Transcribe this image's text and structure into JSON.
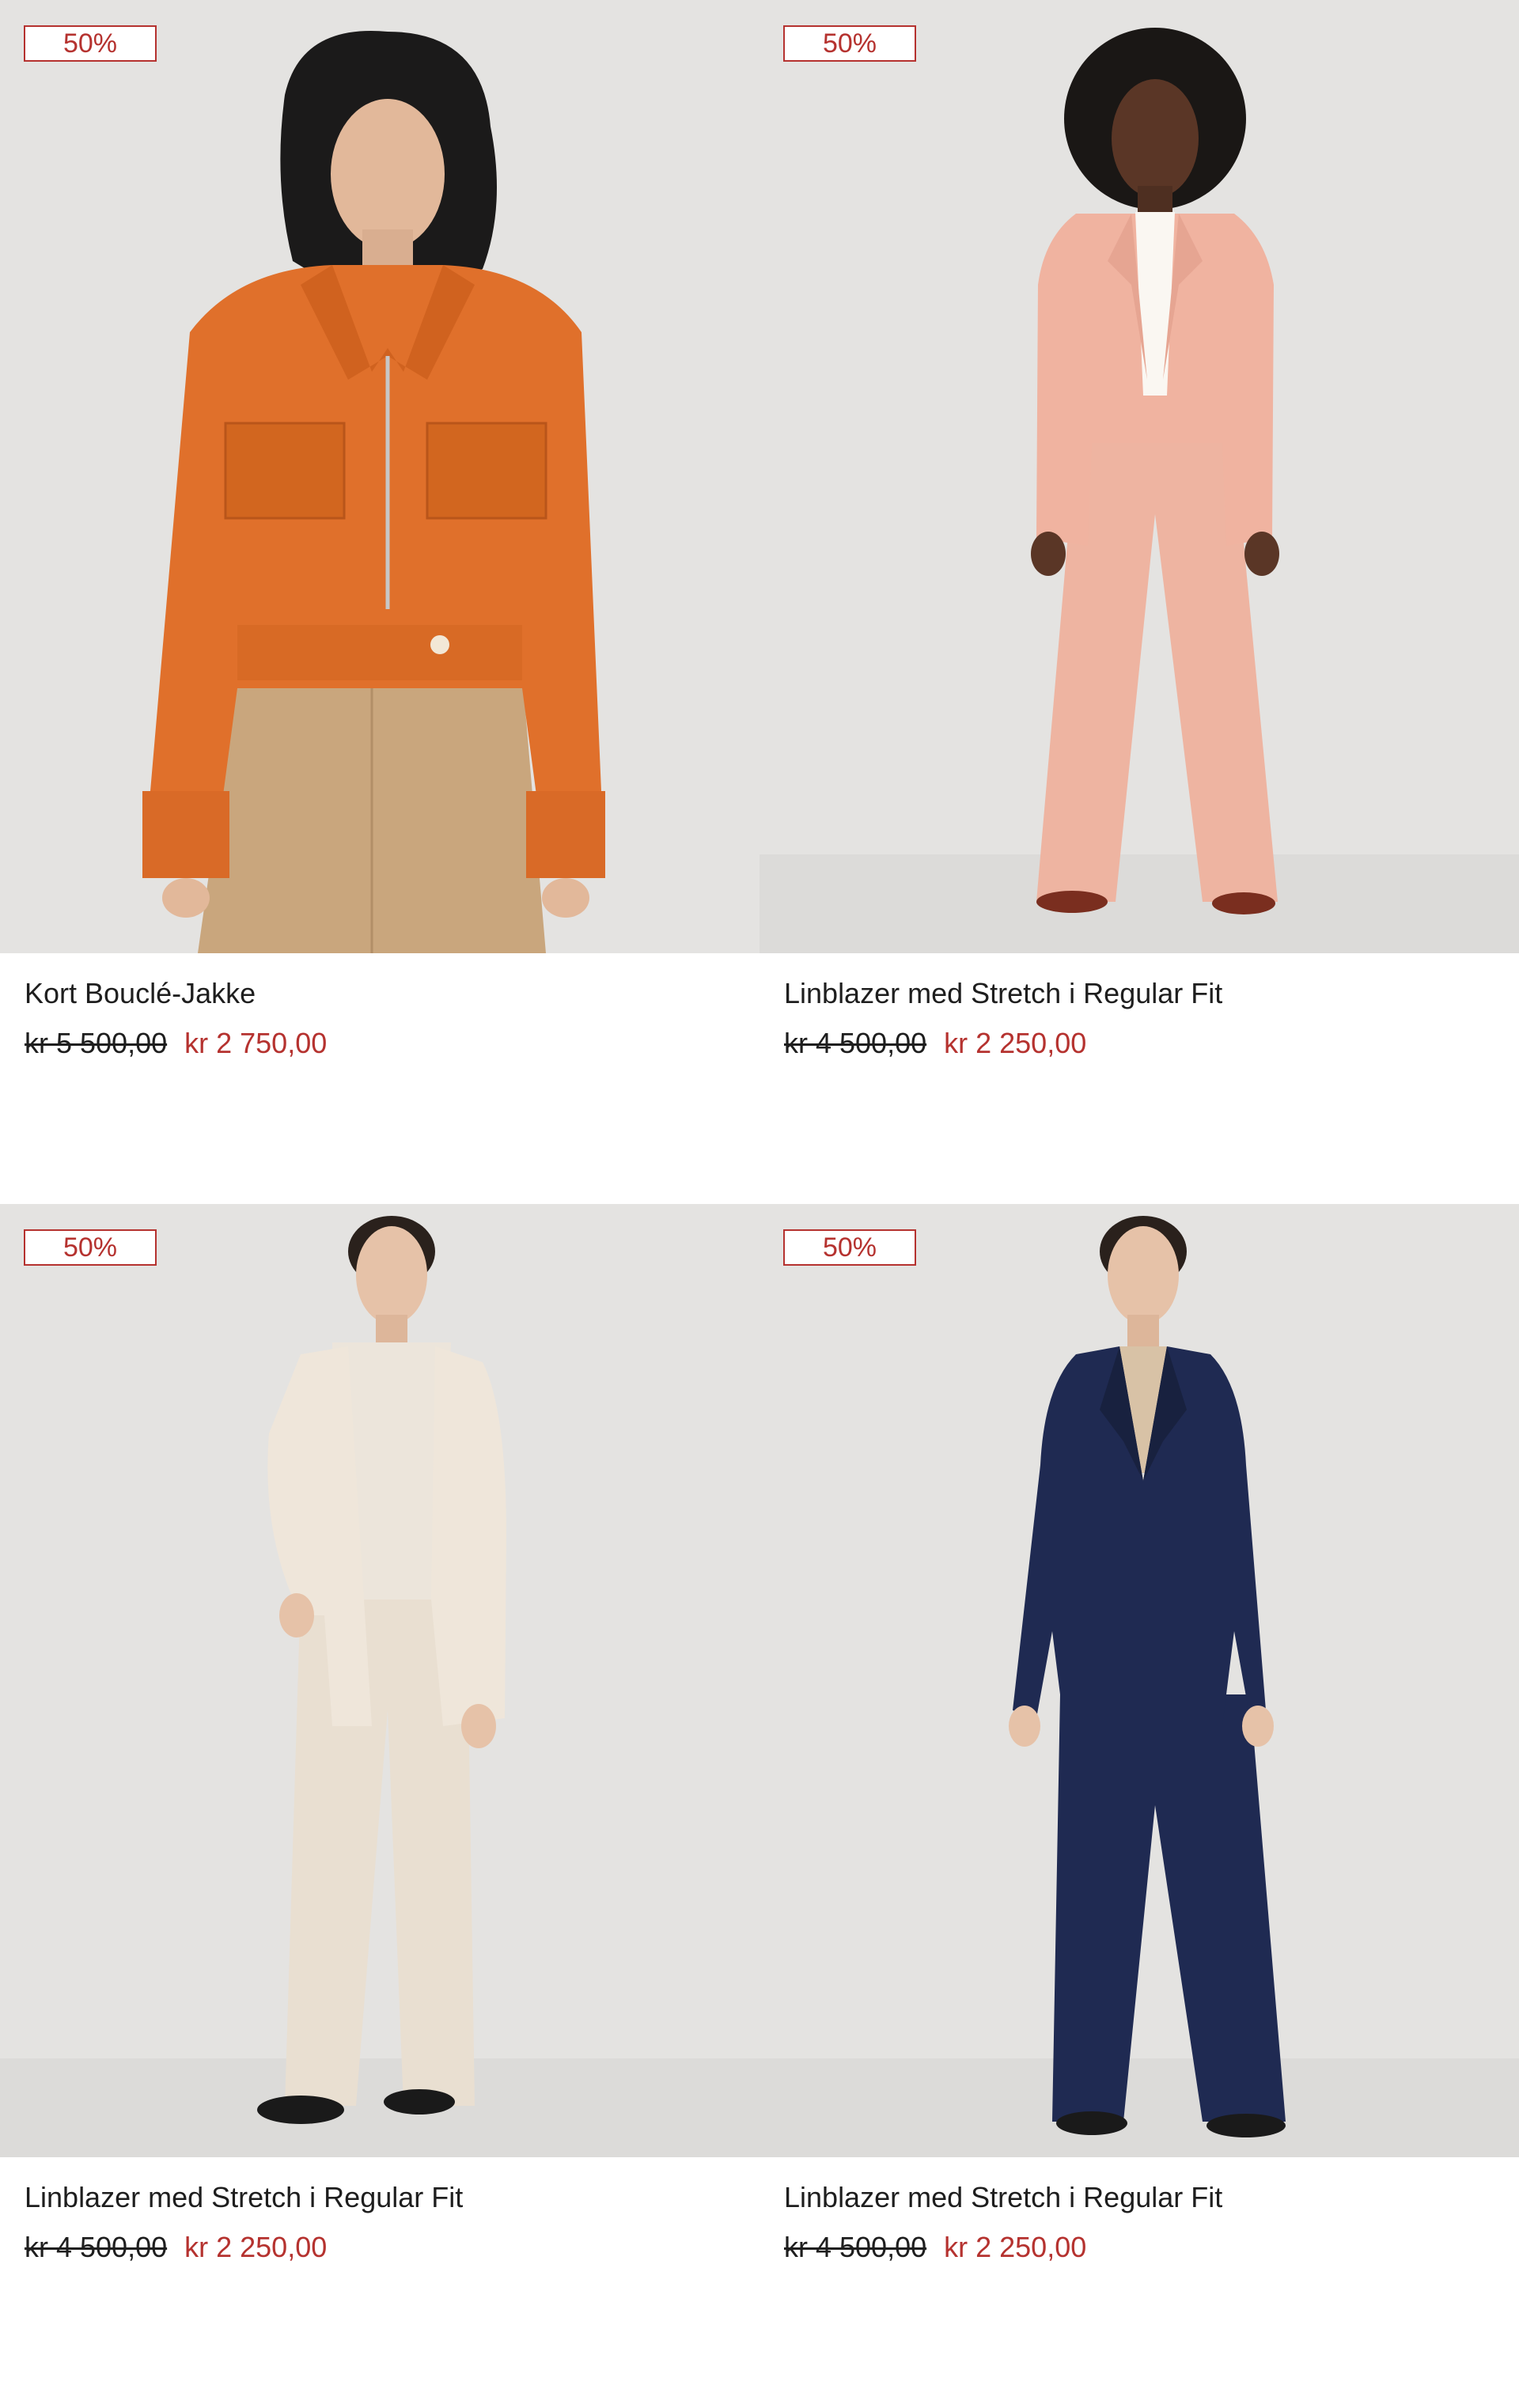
{
  "colors": {
    "sale_red": "#b5322f",
    "text_dark": "#1e1e1e",
    "photo_bg": "#e4e3e1"
  },
  "products": [
    {
      "badge": "50%",
      "name": "Kort Bouclé-Jakke",
      "old_price": "kr 5 500,00",
      "new_price": "kr 2 750,00",
      "garment_color": "#e0702b",
      "bottom_color": "#c9a67d"
    },
    {
      "badge": "50%",
      "name": "Linblazer med Stretch i Regular Fit",
      "old_price": "kr 4 500,00",
      "new_price": "kr 2 250,00",
      "garment_color": "#f0b3a0",
      "bottom_color": "#eeb4a1"
    },
    {
      "badge": "50%",
      "name": "Linblazer med Stretch i Regular Fit",
      "old_price": "kr 4 500,00",
      "new_price": "kr 2 250,00",
      "garment_color": "#efe6da",
      "bottom_color": "#e9dfd1"
    },
    {
      "badge": "50%",
      "name": "Linblazer med Stretch i Regular Fit",
      "old_price": "kr 4 500,00",
      "new_price": "kr 2 250,00",
      "garment_color": "#1f2a52",
      "bottom_color": "#1f2a52"
    }
  ]
}
